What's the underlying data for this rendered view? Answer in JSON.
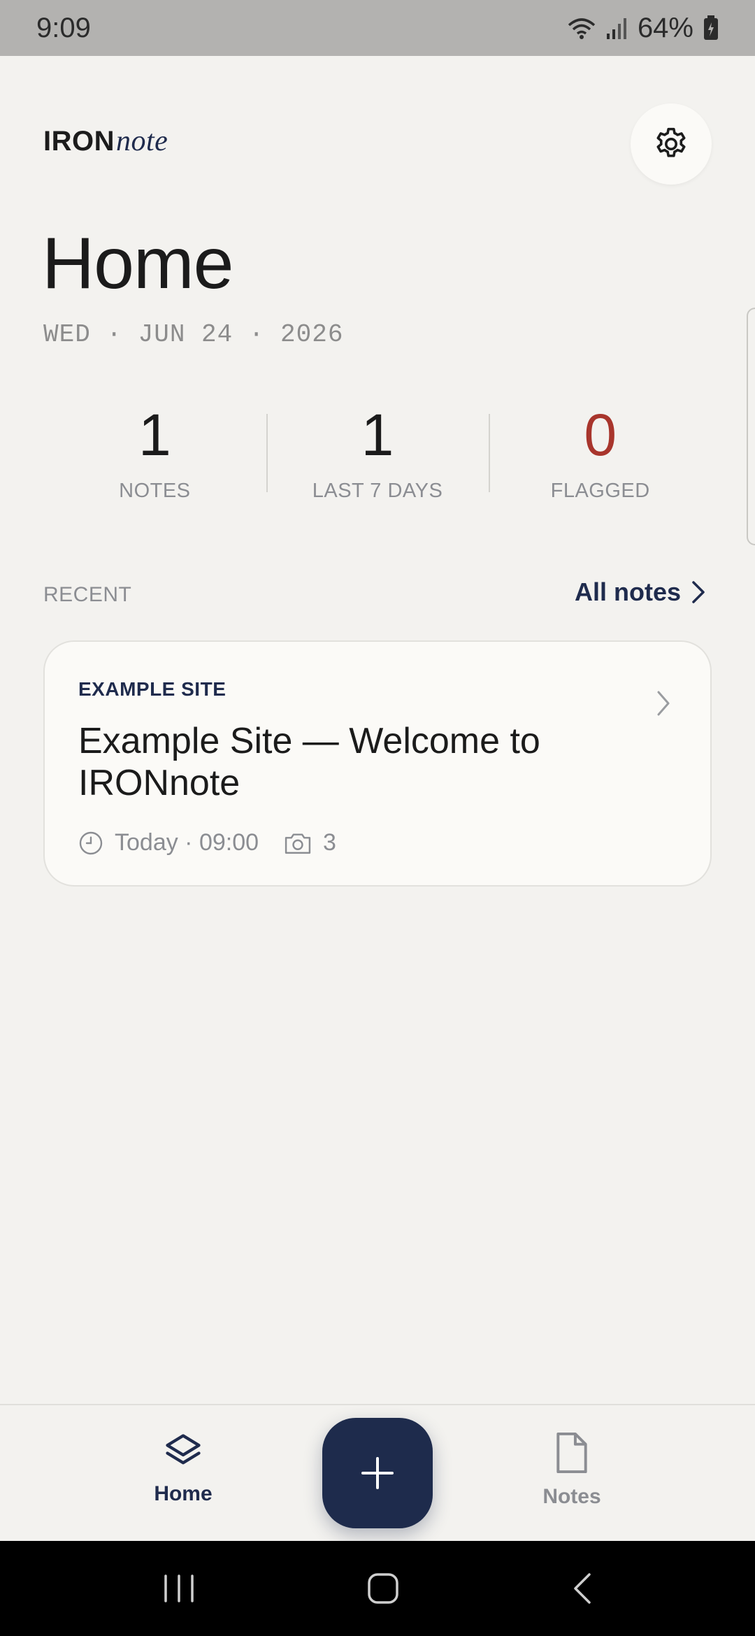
{
  "status_bar": {
    "time": "9:09",
    "battery": "64%",
    "icons": [
      "wifi-icon",
      "signal-icon",
      "battery-icon"
    ]
  },
  "header": {
    "brand_bold": "IRON",
    "brand_italic": "note",
    "settings_icon": "gear-icon"
  },
  "page": {
    "title": "Home",
    "date": "WED · JUN 24 · 2026"
  },
  "stats": [
    {
      "value": "1",
      "label": "NOTES"
    },
    {
      "value": "1",
      "label": "LAST 7 DAYS"
    },
    {
      "value": "0",
      "label": "FLAGGED"
    }
  ],
  "recent": {
    "label": "RECENT",
    "all_notes": "All notes"
  },
  "notes": [
    {
      "site": "EXAMPLE SITE",
      "title": "Example Site — Welcome to IRONnote",
      "time": "Today · 09:00",
      "photos": "3"
    }
  ],
  "bottom_nav": {
    "home_label": "Home",
    "notes_label": "Notes",
    "add_icon": "plus-icon"
  },
  "colors": {
    "background": "#f3f2ef",
    "accent": "#1f2b4d",
    "flagged": "#a8352c",
    "muted": "#8b8d92"
  }
}
